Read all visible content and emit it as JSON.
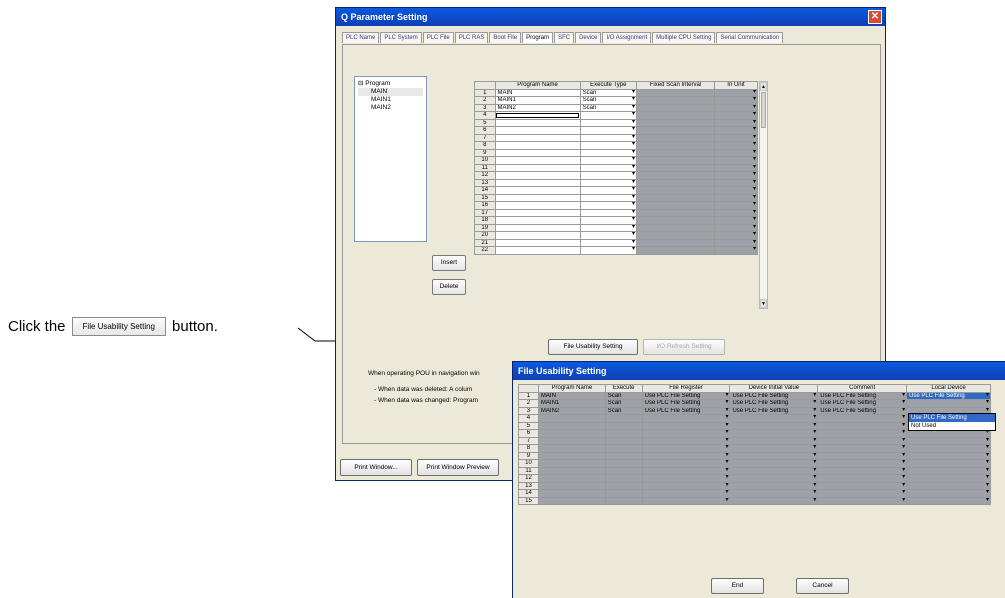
{
  "annotation": {
    "prefix": "Click the",
    "button_label": "File Usability Setting",
    "suffix": "button."
  },
  "main_window": {
    "title": "Q Parameter Setting",
    "tabs": [
      "PLC Name",
      "PLC System",
      "PLC File",
      "PLC RAS",
      "Boot File",
      "Program",
      "SFC",
      "Device",
      "I/O Assignment",
      "Multiple CPU Setting",
      "Serial Communication"
    ],
    "active_tab": "Program",
    "tree": {
      "root": "Program",
      "children": [
        "MAIN",
        "MAIN1",
        "MAIN2"
      ]
    },
    "insert_label": "Insert",
    "delete_label": "Delete",
    "program_table": {
      "headers": [
        "Program Name",
        "Execute Type",
        "Fixed Scan Interval",
        "In Unit"
      ],
      "rows": [
        {
          "num": "1",
          "name": "MAIN",
          "type": "Scan"
        },
        {
          "num": "2",
          "name": "MAIN1",
          "type": "Scan"
        },
        {
          "num": "3",
          "name": "MAIN2",
          "type": "Scan"
        },
        {
          "num": "4",
          "name": "",
          "type": ""
        },
        {
          "num": "5",
          "name": "",
          "type": ""
        },
        {
          "num": "6",
          "name": "",
          "type": ""
        },
        {
          "num": "7",
          "name": "",
          "type": ""
        },
        {
          "num": "8",
          "name": "",
          "type": ""
        },
        {
          "num": "9",
          "name": "",
          "type": ""
        },
        {
          "num": "10",
          "name": "",
          "type": ""
        },
        {
          "num": "11",
          "name": "",
          "type": ""
        },
        {
          "num": "12",
          "name": "",
          "type": ""
        },
        {
          "num": "13",
          "name": "",
          "type": ""
        },
        {
          "num": "14",
          "name": "",
          "type": ""
        },
        {
          "num": "15",
          "name": "",
          "type": ""
        },
        {
          "num": "16",
          "name": "",
          "type": ""
        },
        {
          "num": "17",
          "name": "",
          "type": ""
        },
        {
          "num": "18",
          "name": "",
          "type": ""
        },
        {
          "num": "19",
          "name": "",
          "type": ""
        },
        {
          "num": "20",
          "name": "",
          "type": ""
        },
        {
          "num": "21",
          "name": "",
          "type": ""
        },
        {
          "num": "22",
          "name": "",
          "type": ""
        }
      ]
    },
    "file_usability_label": "File Usability Setting",
    "io_refresh_label": "I/O Refresh Setting",
    "notes": [
      "When operating POU in navigation win",
      "- When data was deleted: A colum",
      "- When data was changed: Program"
    ],
    "print_window_label": "Print Window...",
    "print_preview_label": "Print Window Preview"
  },
  "fu_window": {
    "title": "File Usability Setting",
    "headers": [
      "Program Name",
      "Execute",
      "File Register",
      "Device Initial Value",
      "Comment",
      "Local Device"
    ],
    "rows": [
      {
        "num": "1",
        "name": "MAIN",
        "exec": "Scan",
        "fr": "Use PLC File Setting",
        "div": "Use PLC File Setting",
        "cm": "Use PLC File Setting",
        "ld": "Use PLC File Setting"
      },
      {
        "num": "2",
        "name": "MAIN1",
        "exec": "Scan",
        "fr": "Use PLC File Setting",
        "div": "Use PLC File Setting",
        "cm": "Use PLC File Setting",
        "ld": ""
      },
      {
        "num": "3",
        "name": "MAIN2",
        "exec": "Scan",
        "fr": "Use PLC File Setting",
        "div": "Use PLC File Setting",
        "cm": "Use PLC File Setting",
        "ld": ""
      },
      {
        "num": "4",
        "name": "",
        "exec": "",
        "fr": "",
        "div": "",
        "cm": "",
        "ld": ""
      },
      {
        "num": "5",
        "name": "",
        "exec": "",
        "fr": "",
        "div": "",
        "cm": "",
        "ld": ""
      },
      {
        "num": "6",
        "name": "",
        "exec": "",
        "fr": "",
        "div": "",
        "cm": "",
        "ld": ""
      },
      {
        "num": "7",
        "name": "",
        "exec": "",
        "fr": "",
        "div": "",
        "cm": "",
        "ld": ""
      },
      {
        "num": "8",
        "name": "",
        "exec": "",
        "fr": "",
        "div": "",
        "cm": "",
        "ld": ""
      },
      {
        "num": "9",
        "name": "",
        "exec": "",
        "fr": "",
        "div": "",
        "cm": "",
        "ld": ""
      },
      {
        "num": "10",
        "name": "",
        "exec": "",
        "fr": "",
        "div": "",
        "cm": "",
        "ld": ""
      },
      {
        "num": "11",
        "name": "",
        "exec": "",
        "fr": "",
        "div": "",
        "cm": "",
        "ld": ""
      },
      {
        "num": "12",
        "name": "",
        "exec": "",
        "fr": "",
        "div": "",
        "cm": "",
        "ld": ""
      },
      {
        "num": "13",
        "name": "",
        "exec": "",
        "fr": "",
        "div": "",
        "cm": "",
        "ld": ""
      },
      {
        "num": "14",
        "name": "",
        "exec": "",
        "fr": "",
        "div": "",
        "cm": "",
        "ld": ""
      },
      {
        "num": "15",
        "name": "",
        "exec": "",
        "fr": "",
        "div": "",
        "cm": "",
        "ld": ""
      }
    ],
    "dropdown_options": [
      "Use PLC File Setting",
      "Not Used"
    ],
    "end_label": "End",
    "cancel_label": "Cancel"
  },
  "colors": {
    "title_bar": "#0a5adf",
    "window_bg": "#ece9d8",
    "disabled_cell": "#9ea2a8",
    "highlight": "#316ac5"
  }
}
